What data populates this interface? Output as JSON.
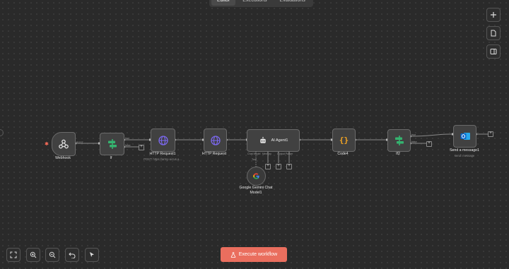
{
  "tabs": [
    {
      "label": "Editor",
      "active": true
    },
    {
      "label": "Executions",
      "active": false
    },
    {
      "label": "Evaluations",
      "active": false
    }
  ],
  "side_buttons": [
    {
      "icon": "plus-icon"
    },
    {
      "icon": "sticky-note-icon"
    },
    {
      "icon": "panel-toggle-icon"
    }
  ],
  "nodes": {
    "webhook": {
      "name": "Webhook",
      "icon": "webhook-icon"
    },
    "if": {
      "name": "If",
      "icon": "if-icon",
      "ports": [
        "true",
        "false"
      ]
    },
    "http_request1": {
      "name": "HTTP Request1",
      "subtitle": "POST: https://army-ai-tus.a...",
      "icon": "globe-icon"
    },
    "http_request": {
      "name": "HTTP Request",
      "icon": "globe-icon"
    },
    "ai_agent1": {
      "name": "AI Agent1",
      "icon": "robot-icon",
      "ports": [
        "Chat Model",
        "Memory",
        "Tool",
        "Output Parser"
      ]
    },
    "gemini": {
      "name": "Google Gemini Chat Model1",
      "icon": "google-icon"
    },
    "code4": {
      "name": "Code4",
      "icon": "code-braces-icon"
    },
    "if2": {
      "name": "If2",
      "icon": "if-icon",
      "ports": [
        "true",
        "false"
      ]
    },
    "send_message": {
      "name": "Send a message1",
      "subtitle": "send: message",
      "icon": "outlook-icon"
    }
  },
  "webhook_port_label": "POST",
  "bottom_toolbar": [
    {
      "icon": "fit-view-icon"
    },
    {
      "icon": "zoom-in-icon"
    },
    {
      "icon": "zoom-out-icon"
    },
    {
      "icon": "undo-icon"
    },
    {
      "icon": "cursor-icon"
    }
  ],
  "execute_button": {
    "label": "Execute workflow",
    "icon": "flask-icon"
  },
  "colors": {
    "canvas": "#2a2a2a",
    "node": "#414141",
    "accent": "#ea6e5e",
    "if_green": "#35b36f",
    "http_purple": "#6f5bd7",
    "code_orange": "#f5a623",
    "outlook_blue": "#0a64c8"
  }
}
